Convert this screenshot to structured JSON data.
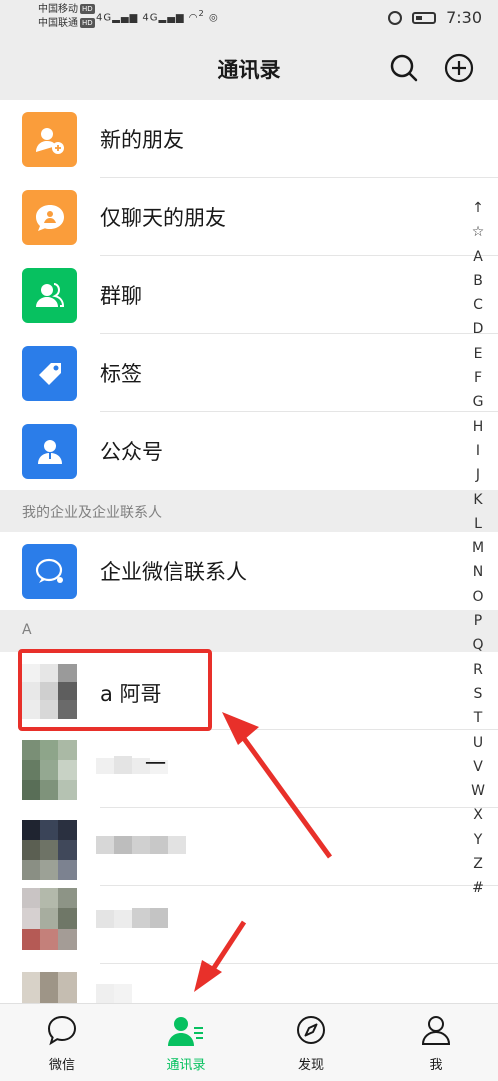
{
  "status_bar": {
    "carrier1": "中国移动",
    "carrier2": "中国联通",
    "hd": "HD",
    "signal": "4G",
    "wifi_count": "2",
    "time": "7:30"
  },
  "header": {
    "title": "通讯录"
  },
  "menu_items": [
    {
      "label": "新的朋友",
      "color": "#fa9d3b",
      "icon": "add-friend-icon"
    },
    {
      "label": "仅聊天的朋友",
      "color": "#fa9d3b",
      "icon": "chat-bubble-icon"
    },
    {
      "label": "群聊",
      "color": "#07c160",
      "icon": "group-icon"
    },
    {
      "label": "标签",
      "color": "#2b7de9",
      "icon": "tag-icon"
    },
    {
      "label": "公众号",
      "color": "#2b7de9",
      "icon": "official-account-icon"
    }
  ],
  "enterprise_section": {
    "header": "我的企业及企业联系人",
    "item_label": "企业微信联系人"
  },
  "contacts_section": {
    "header": "A",
    "contacts": [
      {
        "name": "a 阿哥"
      },
      {
        "name": "一"
      }
    ]
  },
  "index_letters": [
    "↑",
    "☆",
    "A",
    "B",
    "C",
    "D",
    "E",
    "F",
    "G",
    "H",
    "I",
    "J",
    "K",
    "L",
    "M",
    "N",
    "O",
    "P",
    "Q",
    "R",
    "S",
    "T",
    "U",
    "V",
    "W",
    "X",
    "Y",
    "Z",
    "#"
  ],
  "tabs": [
    {
      "label": "微信",
      "icon": "chat-icon"
    },
    {
      "label": "通讯录",
      "icon": "contacts-icon",
      "active": true
    },
    {
      "label": "发现",
      "icon": "compass-icon"
    },
    {
      "label": "我",
      "icon": "person-icon"
    }
  ],
  "colors": {
    "accent": "#07c160",
    "highlight": "#e8302a"
  }
}
